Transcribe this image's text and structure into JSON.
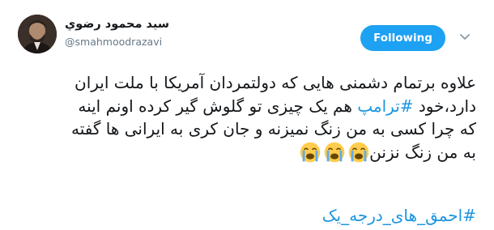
{
  "user": {
    "display_name": "سيد محمود رضوي",
    "handle": "@smahmoodrazavi"
  },
  "follow_button": {
    "label": "Following"
  },
  "tweet": {
    "line1": "علاوه برتمام دشمنی هایی که دولتمردان آمریکا با ملت ایران",
    "line2_before": "دارد،خود ",
    "line2_hashtag": "#ترامپ",
    "line2_after": " هم یک چیزی تو گلوش گیر کرده اونم اینه",
    "line3": "که چرا کسی به من زنگ نمیزنه و جان کری به ایرانی ها گفته",
    "line4": "به من زنگ نزنن",
    "emojis": [
      "loudly-crying-face",
      "loudly-crying-face",
      "loudly-crying-face"
    ],
    "hashtag_line": "#احمق_های_درجه_یک"
  },
  "colors": {
    "accent": "#1da1f2",
    "hashtag": "#1b95e0",
    "text": "#14171a",
    "muted": "#657786"
  }
}
